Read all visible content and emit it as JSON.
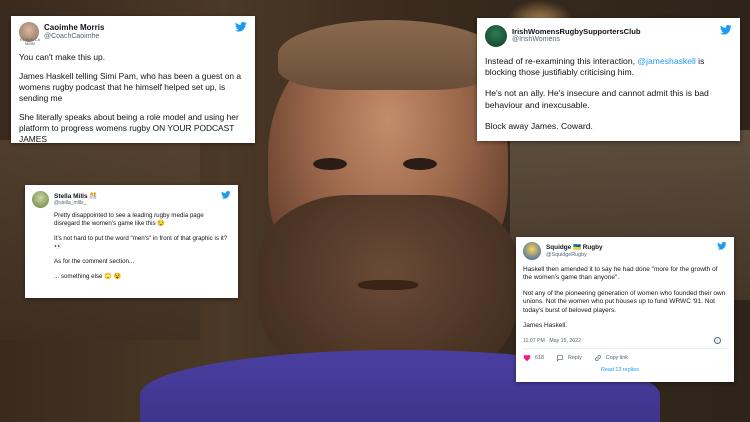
{
  "tweets": [
    {
      "display_name": "Caoimhe Morris",
      "handle": "@CoachCaoimhe",
      "avatar_caption": "ROISIN CA MMM",
      "paragraphs": [
        "You can't make this up.",
        "James Haskell telling Simi Pam, who has been a guest on a womens rugby podcast that he himself helped set up, is sending me",
        "She literally speaks about being a role model and using her platform to progress womens rugby ON YOUR PODCAST JAMES"
      ]
    },
    {
      "display_name": "IrishWomensRugbySupportersClub",
      "handle": "@IrishWomens",
      "p1_before": "Instead of re-examining this interaction, ",
      "p1_mention": "@jameshaskell",
      "p1_after": " is blocking those justifiably criticising him.",
      "p2": "He's not an ally. He's insecure and cannot admit this is bad behaviour and inexcusable.",
      "p3": "Block away James. Coward."
    },
    {
      "display_name": "Stella Mills 🎊",
      "handle": "@stella_mills_",
      "paragraphs": [
        "Pretty disappointed to see a leading rugby media page disregard the women's game like this 😒",
        "It's not hard to put the word \"men's\" in front of that graphic is it? 👀",
        "As for the comment section...",
        "... something else 🙄 😵"
      ]
    },
    {
      "display_name": "Squidge 🇺🇦 Rugby",
      "handle": "@SquidgeRugby",
      "paragraphs": [
        "Haskell then amended it to say he had done \"more for the growth of the women's game than anyone\".",
        "Not any of the pioneering generation of women who founded their own unions. Not the women who put houses up to fund WRWC '91. Not today's burst of beloved players.",
        "James Haskell."
      ],
      "timestamp": "11:07 PM · May 15, 2022",
      "likes": "618",
      "reply_label": "Reply",
      "copy_link_label": "Copy link",
      "read_replies": "Read 13 replies"
    }
  ],
  "colors": {
    "twitter_blue": "#1d9bf0",
    "like_red": "#f91880",
    "text": "#0f1419",
    "muted": "#536471"
  },
  "icons": [
    "twitter-bird-icon",
    "heart-icon",
    "reply-icon",
    "link-icon",
    "info-icon"
  ]
}
